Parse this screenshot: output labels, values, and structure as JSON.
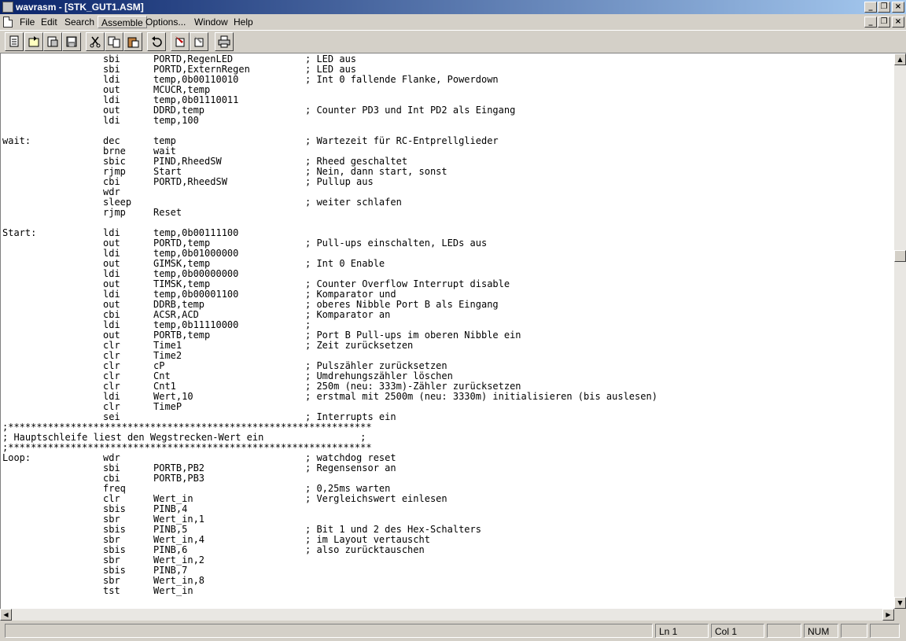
{
  "window": {
    "title": "wavrasm - [STK_GUT1.ASM]"
  },
  "menu": {
    "items": [
      {
        "label": "File"
      },
      {
        "label": "Edit"
      },
      {
        "label": "Search"
      },
      {
        "label": "Assemble"
      },
      {
        "label": "Options..."
      },
      {
        "label": "Window"
      },
      {
        "label": "Help"
      }
    ]
  },
  "toolbar": {
    "buttons": [
      "new-file-icon",
      "open-file-icon",
      "open-alt-icon",
      "save-icon",
      "cut-icon",
      "copy-icon",
      "paste-icon",
      "undo-icon",
      "assemble-icon",
      "assemble-alt-icon",
      "print-icon"
    ]
  },
  "code": {
    "lines": [
      {
        "label": "",
        "op": "sbi",
        "args": "PORTD,RegenLED",
        "comment": "; LED aus"
      },
      {
        "label": "",
        "op": "sbi",
        "args": "PORTD,ExternRegen",
        "comment": "; LED aus"
      },
      {
        "label": "",
        "op": "ldi",
        "args": "temp,0b00110010",
        "comment": "; Int 0 fallende Flanke, Powerdown"
      },
      {
        "label": "",
        "op": "out",
        "args": "MCUCR,temp",
        "comment": ""
      },
      {
        "label": "",
        "op": "ldi",
        "args": "temp,0b01110011",
        "comment": ""
      },
      {
        "label": "",
        "op": "out",
        "args": "DDRD,temp",
        "comment": "; Counter PD3 und Int PD2 als Eingang"
      },
      {
        "label": "",
        "op": "ldi",
        "args": "temp,100",
        "comment": ""
      },
      {
        "label": "",
        "op": "",
        "args": "",
        "comment": ""
      },
      {
        "label": "wait:",
        "op": "dec",
        "args": "temp",
        "comment": "; Wartezeit für RC-Entprellglieder"
      },
      {
        "label": "",
        "op": "brne",
        "args": "wait",
        "comment": ""
      },
      {
        "label": "",
        "op": "sbic",
        "args": "PIND,RheedSW",
        "comment": "; Rheed geschaltet"
      },
      {
        "label": "",
        "op": "rjmp",
        "args": "Start",
        "comment": "; Nein, dann start, sonst"
      },
      {
        "label": "",
        "op": "cbi",
        "args": "PORTD,RheedSW",
        "comment": "; Pullup aus"
      },
      {
        "label": "",
        "op": "wdr",
        "args": "",
        "comment": ""
      },
      {
        "label": "",
        "op": "sleep",
        "args": "",
        "comment": "; weiter schlafen"
      },
      {
        "label": "",
        "op": "rjmp",
        "args": "Reset",
        "comment": ""
      },
      {
        "label": "",
        "op": "",
        "args": "",
        "comment": ""
      },
      {
        "label": "Start:",
        "op": "ldi",
        "args": "temp,0b00111100",
        "comment": ""
      },
      {
        "label": "",
        "op": "out",
        "args": "PORTD,temp",
        "comment": "; Pull-ups einschalten, LEDs aus"
      },
      {
        "label": "",
        "op": "ldi",
        "args": "temp,0b01000000",
        "comment": ""
      },
      {
        "label": "",
        "op": "out",
        "args": "GIMSK,temp",
        "comment": "; Int 0 Enable"
      },
      {
        "label": "",
        "op": "ldi",
        "args": "temp,0b00000000",
        "comment": ""
      },
      {
        "label": "",
        "op": "out",
        "args": "TIMSK,temp",
        "comment": "; Counter Overflow Interrupt disable"
      },
      {
        "label": "",
        "op": "ldi",
        "args": "temp,0b00001100",
        "comment": "; Komparator und"
      },
      {
        "label": "",
        "op": "out",
        "args": "DDRB,temp",
        "comment": "; oberes Nibble Port B als Eingang"
      },
      {
        "label": "",
        "op": "cbi",
        "args": "ACSR,ACD",
        "comment": "; Komparator an"
      },
      {
        "label": "",
        "op": "ldi",
        "args": "temp,0b11110000",
        "comment": ";"
      },
      {
        "label": "",
        "op": "out",
        "args": "PORTB,temp",
        "comment": "; Port B Pull-ups im oberen Nibble ein"
      },
      {
        "label": "",
        "op": "clr",
        "args": "Time1",
        "comment": "; Zeit zurücksetzen"
      },
      {
        "label": "",
        "op": "clr",
        "args": "Time2",
        "comment": ""
      },
      {
        "label": "",
        "op": "clr",
        "args": "cP",
        "comment": "; Pulszähler zurücksetzen"
      },
      {
        "label": "",
        "op": "clr",
        "args": "Cnt",
        "comment": "; Umdrehungszähler löschen"
      },
      {
        "label": "",
        "op": "clr",
        "args": "Cnt1",
        "comment": "; 250m (neu: 333m)-Zähler zurücksetzen"
      },
      {
        "label": "",
        "op": "ldi",
        "args": "Wert,10",
        "comment": "; erstmal mit 2500m (neu: 3330m) initialisieren (bis auslesen)"
      },
      {
        "label": "",
        "op": "clr",
        "args": "TimeP",
        "comment": ""
      },
      {
        "label": "",
        "op": "sei",
        "args": "",
        "comment": "; Interrupts ein"
      },
      {
        "label": ";****************************************************************",
        "op": "",
        "args": "",
        "comment": ""
      },
      {
        "label": "; Hauptschleife liest den Wegstrecken-Wert ein                 ;",
        "op": "",
        "args": "",
        "comment": ""
      },
      {
        "label": ";****************************************************************",
        "op": "",
        "args": "",
        "comment": ""
      },
      {
        "label": "Loop:",
        "op": "wdr",
        "args": "",
        "comment": "; watchdog reset"
      },
      {
        "label": "",
        "op": "sbi",
        "args": "PORTB,PB2",
        "comment": "; Regensensor an"
      },
      {
        "label": "",
        "op": "cbi",
        "args": "PORTB,PB3",
        "comment": ""
      },
      {
        "label": "",
        "op": "freq",
        "args": "",
        "comment": "; 0,25ms warten"
      },
      {
        "label": "",
        "op": "clr",
        "args": "Wert_in",
        "comment": "; Vergleichswert einlesen"
      },
      {
        "label": "",
        "op": "sbis",
        "args": "PINB,4",
        "comment": ""
      },
      {
        "label": "",
        "op": "sbr",
        "args": "Wert_in,1",
        "comment": ""
      },
      {
        "label": "",
        "op": "sbis",
        "args": "PINB,5",
        "comment": "; Bit 1 und 2 des Hex-Schalters"
      },
      {
        "label": "",
        "op": "sbr",
        "args": "Wert_in,4",
        "comment": "; im Layout vertauscht"
      },
      {
        "label": "",
        "op": "sbis",
        "args": "PINB,6",
        "comment": "; also zurücktauschen"
      },
      {
        "label": "",
        "op": "sbr",
        "args": "Wert_in,2",
        "comment": ""
      },
      {
        "label": "",
        "op": "sbis",
        "args": "PINB,7",
        "comment": ""
      },
      {
        "label": "",
        "op": "sbr",
        "args": "Wert_in,8",
        "comment": ""
      },
      {
        "label": "",
        "op": "tst",
        "args": "Wert_in",
        "comment": ""
      }
    ]
  },
  "status": {
    "line": "Ln 1",
    "col": "Col 1",
    "num": "NUM"
  }
}
